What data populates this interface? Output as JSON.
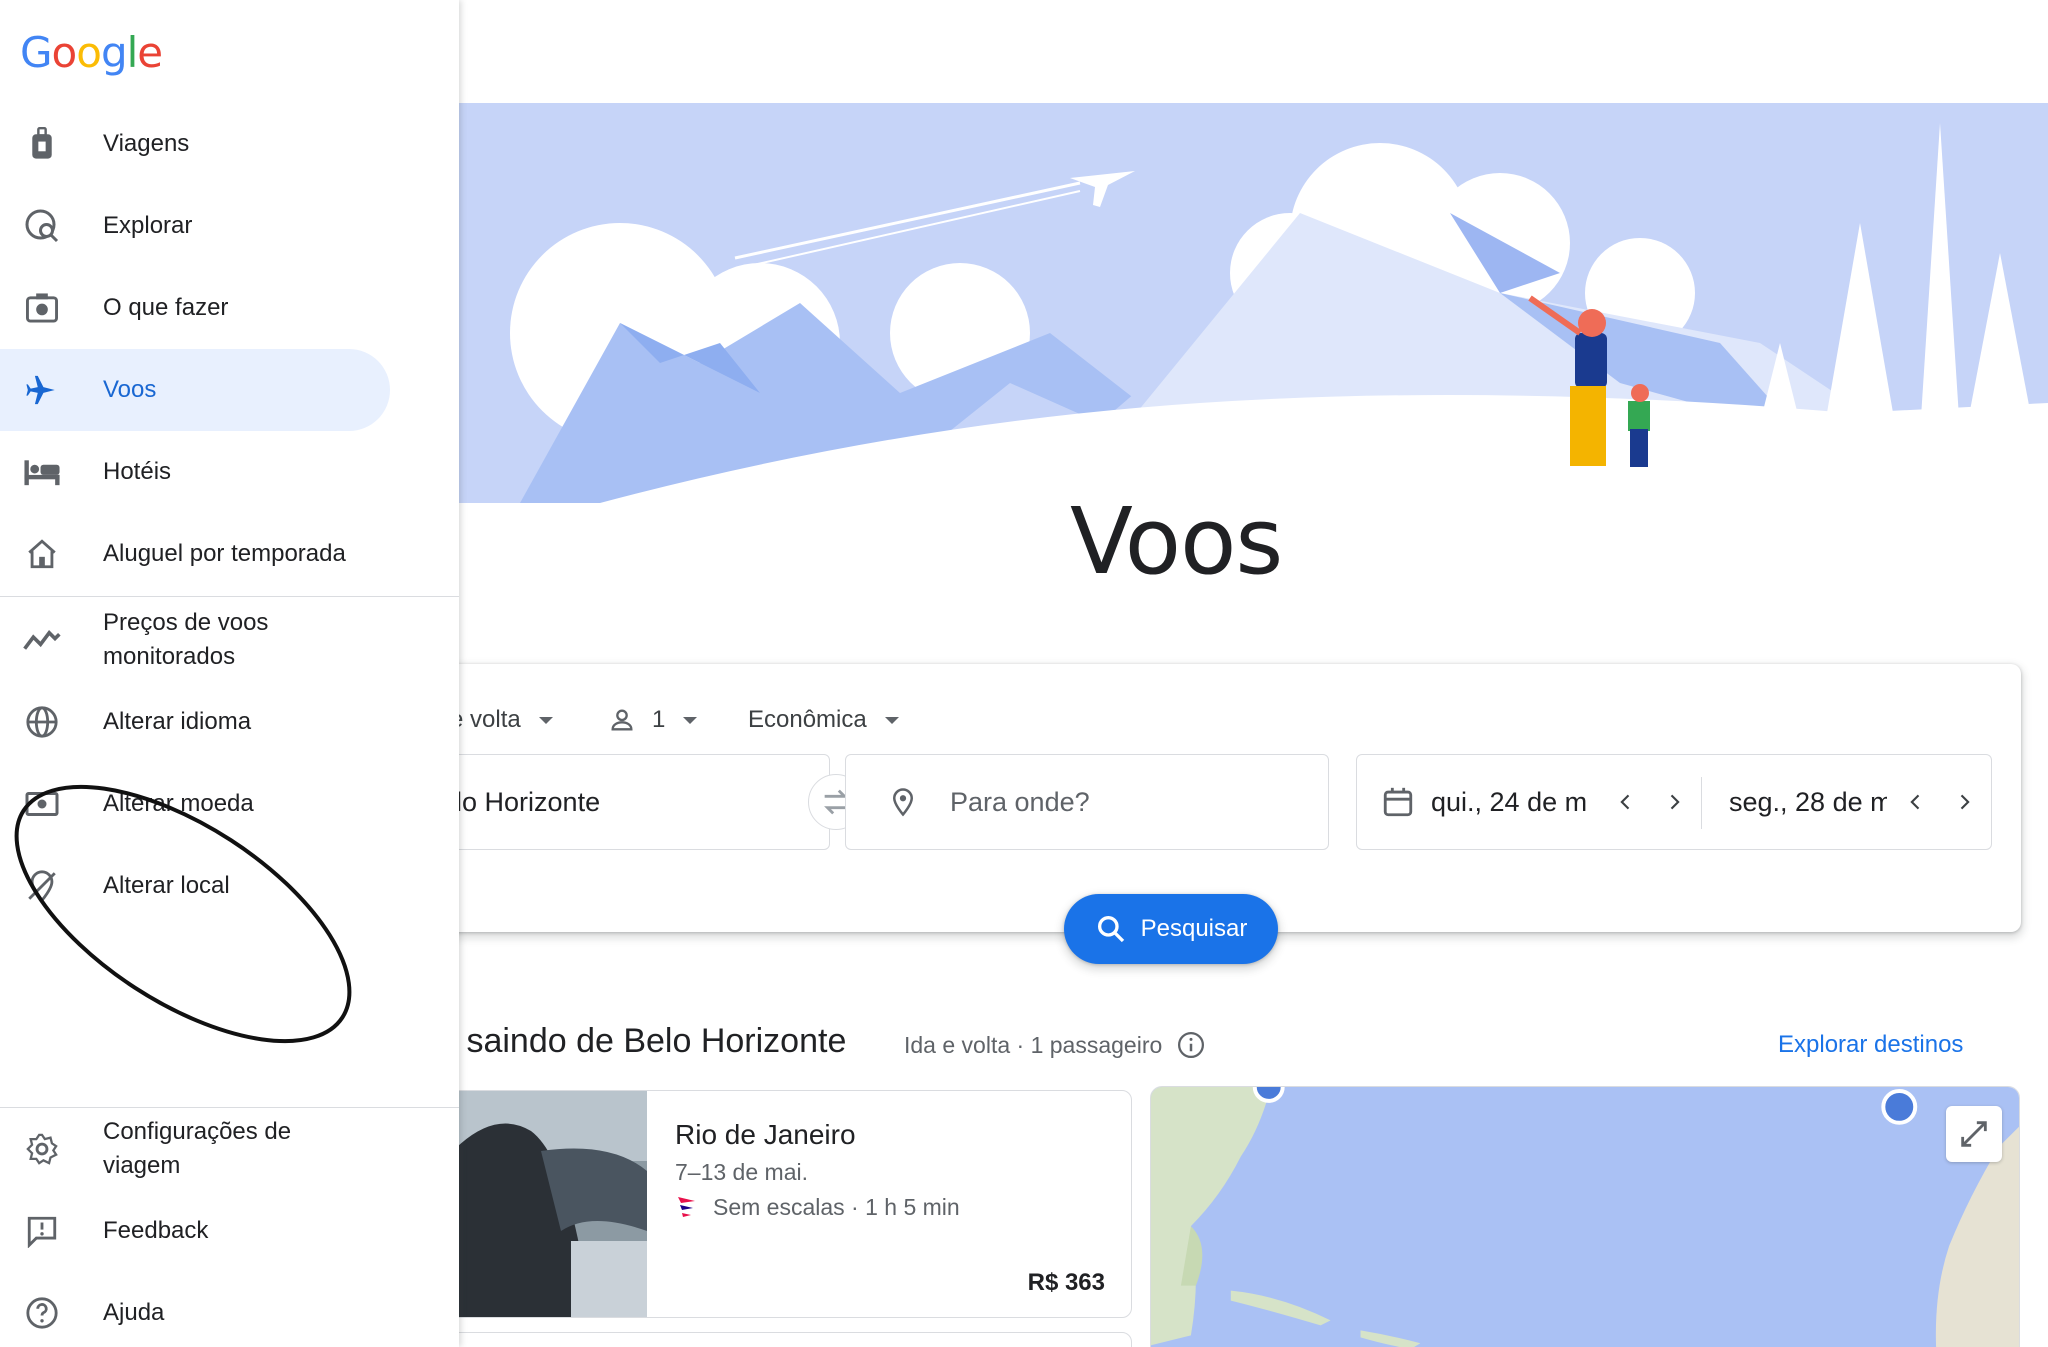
{
  "brand": {
    "logo": "Google",
    "colors": {
      "blue": "#4285F4",
      "red": "#EA4335",
      "yellow": "#FBBC05",
      "green": "#34A853",
      "accent": "#1a73e8",
      "active_bg": "#e8f0fe"
    }
  },
  "drawer": {
    "items": [
      {
        "label": "Viagens",
        "icon": "luggage-icon"
      },
      {
        "label": "Explorar",
        "icon": "explore-globe-icon"
      },
      {
        "label": "O que fazer",
        "icon": "camera-icon"
      },
      {
        "label": "Voos",
        "icon": "airplane-icon",
        "active": true
      },
      {
        "label": "Hotéis",
        "icon": "bed-icon"
      },
      {
        "label": "Aluguel por temporada",
        "icon": "home-icon"
      },
      {
        "label": "Preços de voos monitorados",
        "icon": "trend-line-icon"
      },
      {
        "label": "Alterar idioma",
        "icon": "globe-icon"
      },
      {
        "label": "Alterar moeda",
        "icon": "money-icon"
      },
      {
        "label": "Alterar local",
        "icon": "location-off-icon"
      },
      {
        "label": "Configurações de viagem",
        "icon": "gear-icon"
      },
      {
        "label": "Feedback",
        "icon": "feedback-icon"
      },
      {
        "label": "Ajuda",
        "icon": "help-icon"
      }
    ]
  },
  "main": {
    "title": "Voos",
    "search": {
      "trip_type": "e volta",
      "passengers": "1",
      "cabin": "Econômica",
      "origin": "elo Horizonte",
      "destination_placeholder": "Para onde?",
      "depart": "qui., 24 de m",
      "return": "seg., 28 de m",
      "button": "Pesquisar"
    },
    "section": {
      "title": "s saindo de Belo Horizonte",
      "subtitle": "Ida e volta · 1 passageiro",
      "link": "Explorar destinos"
    },
    "destinations": [
      {
        "name": "Rio de Janeiro",
        "dates": "7–13 de mai.",
        "info": "Sem escalas · 1 h 5 min",
        "price": "R$ 363"
      }
    ]
  }
}
